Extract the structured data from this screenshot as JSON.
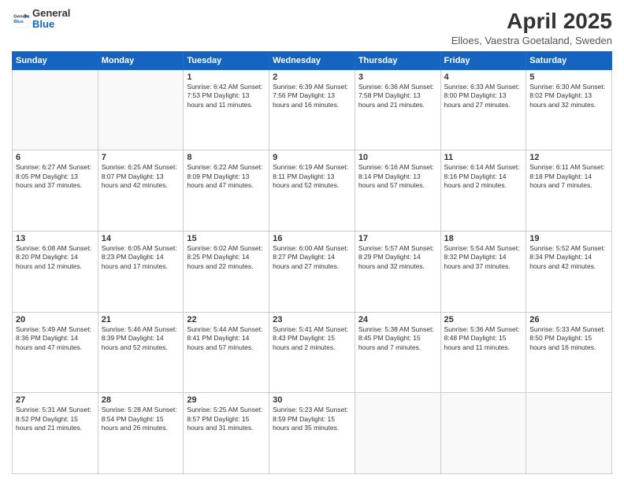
{
  "header": {
    "logo_general": "General",
    "logo_blue": "Blue",
    "title": "April 2025",
    "subtitle": "Elloes, Vaestra Goetaland, Sweden"
  },
  "weekdays": [
    "Sunday",
    "Monday",
    "Tuesday",
    "Wednesday",
    "Thursday",
    "Friday",
    "Saturday"
  ],
  "weeks": [
    [
      {
        "day": "",
        "info": ""
      },
      {
        "day": "",
        "info": ""
      },
      {
        "day": "1",
        "info": "Sunrise: 6:42 AM\nSunset: 7:53 PM\nDaylight: 13 hours and 11 minutes."
      },
      {
        "day": "2",
        "info": "Sunrise: 6:39 AM\nSunset: 7:56 PM\nDaylight: 13 hours and 16 minutes."
      },
      {
        "day": "3",
        "info": "Sunrise: 6:36 AM\nSunset: 7:58 PM\nDaylight: 13 hours and 21 minutes."
      },
      {
        "day": "4",
        "info": "Sunrise: 6:33 AM\nSunset: 8:00 PM\nDaylight: 13 hours and 27 minutes."
      },
      {
        "day": "5",
        "info": "Sunrise: 6:30 AM\nSunset: 8:02 PM\nDaylight: 13 hours and 32 minutes."
      }
    ],
    [
      {
        "day": "6",
        "info": "Sunrise: 6:27 AM\nSunset: 8:05 PM\nDaylight: 13 hours and 37 minutes."
      },
      {
        "day": "7",
        "info": "Sunrise: 6:25 AM\nSunset: 8:07 PM\nDaylight: 13 hours and 42 minutes."
      },
      {
        "day": "8",
        "info": "Sunrise: 6:22 AM\nSunset: 8:09 PM\nDaylight: 13 hours and 47 minutes."
      },
      {
        "day": "9",
        "info": "Sunrise: 6:19 AM\nSunset: 8:11 PM\nDaylight: 13 hours and 52 minutes."
      },
      {
        "day": "10",
        "info": "Sunrise: 6:16 AM\nSunset: 8:14 PM\nDaylight: 13 hours and 57 minutes."
      },
      {
        "day": "11",
        "info": "Sunrise: 6:14 AM\nSunset: 8:16 PM\nDaylight: 14 hours and 2 minutes."
      },
      {
        "day": "12",
        "info": "Sunrise: 6:11 AM\nSunset: 8:18 PM\nDaylight: 14 hours and 7 minutes."
      }
    ],
    [
      {
        "day": "13",
        "info": "Sunrise: 6:08 AM\nSunset: 8:20 PM\nDaylight: 14 hours and 12 minutes."
      },
      {
        "day": "14",
        "info": "Sunrise: 6:05 AM\nSunset: 8:23 PM\nDaylight: 14 hours and 17 minutes."
      },
      {
        "day": "15",
        "info": "Sunrise: 6:02 AM\nSunset: 8:25 PM\nDaylight: 14 hours and 22 minutes."
      },
      {
        "day": "16",
        "info": "Sunrise: 6:00 AM\nSunset: 8:27 PM\nDaylight: 14 hours and 27 minutes."
      },
      {
        "day": "17",
        "info": "Sunrise: 5:57 AM\nSunset: 8:29 PM\nDaylight: 14 hours and 32 minutes."
      },
      {
        "day": "18",
        "info": "Sunrise: 5:54 AM\nSunset: 8:32 PM\nDaylight: 14 hours and 37 minutes."
      },
      {
        "day": "19",
        "info": "Sunrise: 5:52 AM\nSunset: 8:34 PM\nDaylight: 14 hours and 42 minutes."
      }
    ],
    [
      {
        "day": "20",
        "info": "Sunrise: 5:49 AM\nSunset: 8:36 PM\nDaylight: 14 hours and 47 minutes."
      },
      {
        "day": "21",
        "info": "Sunrise: 5:46 AM\nSunset: 8:39 PM\nDaylight: 14 hours and 52 minutes."
      },
      {
        "day": "22",
        "info": "Sunrise: 5:44 AM\nSunset: 8:41 PM\nDaylight: 14 hours and 57 minutes."
      },
      {
        "day": "23",
        "info": "Sunrise: 5:41 AM\nSunset: 8:43 PM\nDaylight: 15 hours and 2 minutes."
      },
      {
        "day": "24",
        "info": "Sunrise: 5:38 AM\nSunset: 8:45 PM\nDaylight: 15 hours and 7 minutes."
      },
      {
        "day": "25",
        "info": "Sunrise: 5:36 AM\nSunset: 8:48 PM\nDaylight: 15 hours and 11 minutes."
      },
      {
        "day": "26",
        "info": "Sunrise: 5:33 AM\nSunset: 8:50 PM\nDaylight: 15 hours and 16 minutes."
      }
    ],
    [
      {
        "day": "27",
        "info": "Sunrise: 5:31 AM\nSunset: 8:52 PM\nDaylight: 15 hours and 21 minutes."
      },
      {
        "day": "28",
        "info": "Sunrise: 5:28 AM\nSunset: 8:54 PM\nDaylight: 15 hours and 26 minutes."
      },
      {
        "day": "29",
        "info": "Sunrise: 5:25 AM\nSunset: 8:57 PM\nDaylight: 15 hours and 31 minutes."
      },
      {
        "day": "30",
        "info": "Sunrise: 5:23 AM\nSunset: 8:59 PM\nDaylight: 15 hours and 35 minutes."
      },
      {
        "day": "",
        "info": ""
      },
      {
        "day": "",
        "info": ""
      },
      {
        "day": "",
        "info": ""
      }
    ]
  ]
}
